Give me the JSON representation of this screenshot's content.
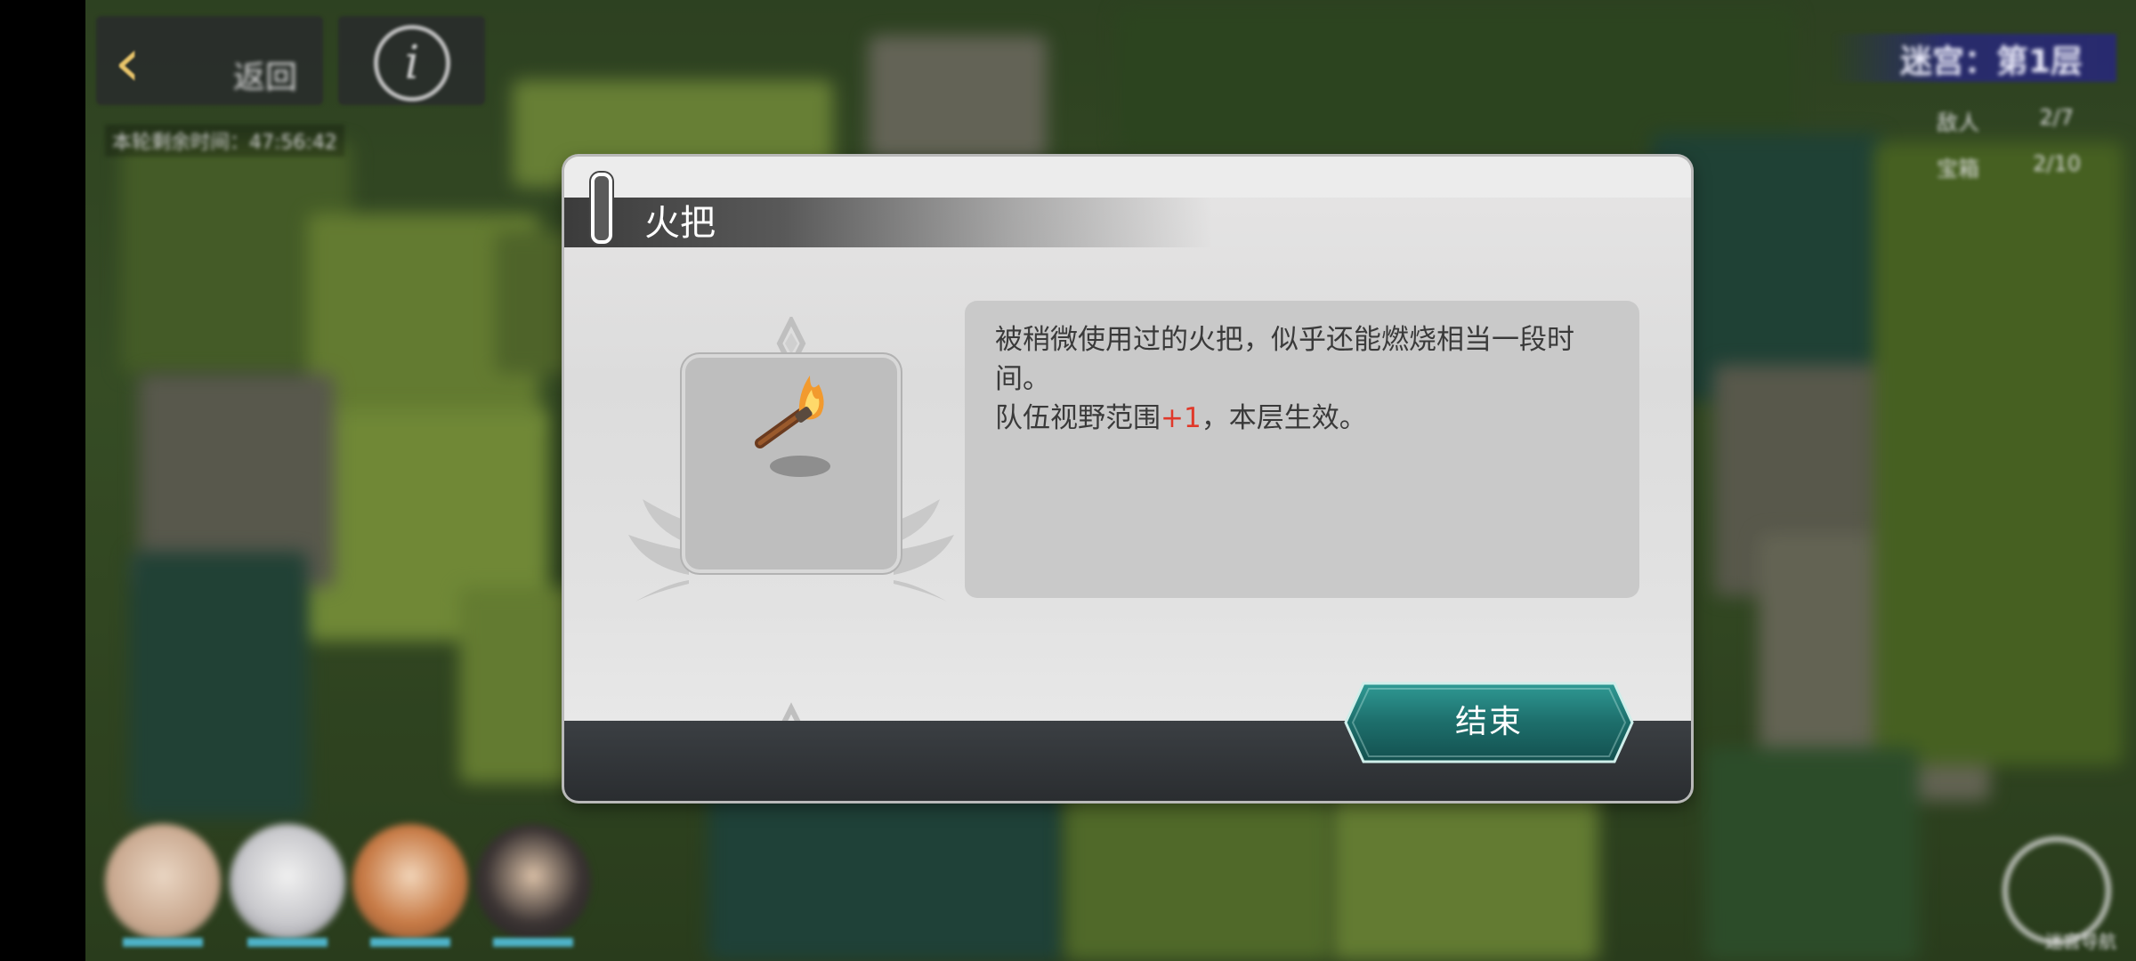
{
  "header": {
    "back_label": "返回",
    "info_icon": "info-icon",
    "timer": "本轮剩余时间：47:56:42"
  },
  "floor": {
    "label": "迷宫：第1层",
    "stats": [
      {
        "label": "敌人",
        "value": "2/7"
      },
      {
        "label": "宝箱",
        "value": "2/10"
      }
    ]
  },
  "dialog": {
    "title": "火把",
    "item_icon": "torch-icon",
    "description_line1": "被稍微使用过的火把，似乎还能燃烧相当一段时间。",
    "description_line2_prefix": "队伍视野范围",
    "description_line2_highlight": "+1",
    "description_line2_suffix": "，本层生效。",
    "end_button": "结束"
  },
  "compass": {
    "icon": "compass-icon",
    "label": "迷宫导航"
  },
  "colors": {
    "highlight": "#e0392a",
    "button_teal": "#1e7b78",
    "accent_gold": "#e8c46a"
  }
}
